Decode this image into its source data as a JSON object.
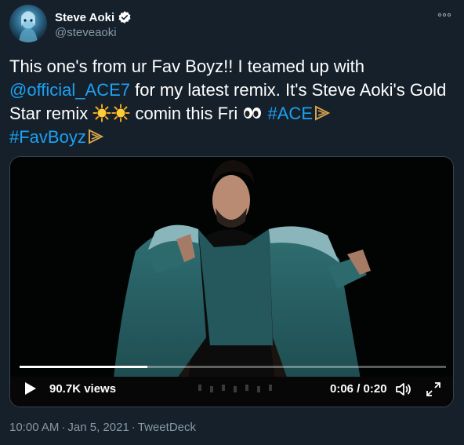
{
  "author": {
    "display_name": "Steve Aoki",
    "handle": "@steveaoki",
    "verified": true
  },
  "tweet": {
    "segments": {
      "s1": "This one's from ur Fav Boyz!! I teamed up with ",
      "mention": "@official_ACE7",
      "s2": " for my latest remix. It's Steve Aoki's Gold Star remix ",
      "s3": " comin this Fri ",
      "hashtag1": "#ACE",
      "hashtag2": "#FavBoyz"
    },
    "emojis": [
      "sun-emoji",
      "sun-emoji",
      "eyes-emoji"
    ]
  },
  "video": {
    "views": "90.7K views",
    "timecode": "0:06 / 0:20",
    "progress": 0.3
  },
  "meta": {
    "time": "10:00 AM",
    "dot": "·",
    "date": "Jan 5, 2021",
    "source": "TweetDeck"
  },
  "colors": {
    "background": "#15202b",
    "link": "#1da1f2",
    "secondary_text": "#8899a6",
    "verified_badge": "#ffffff"
  }
}
